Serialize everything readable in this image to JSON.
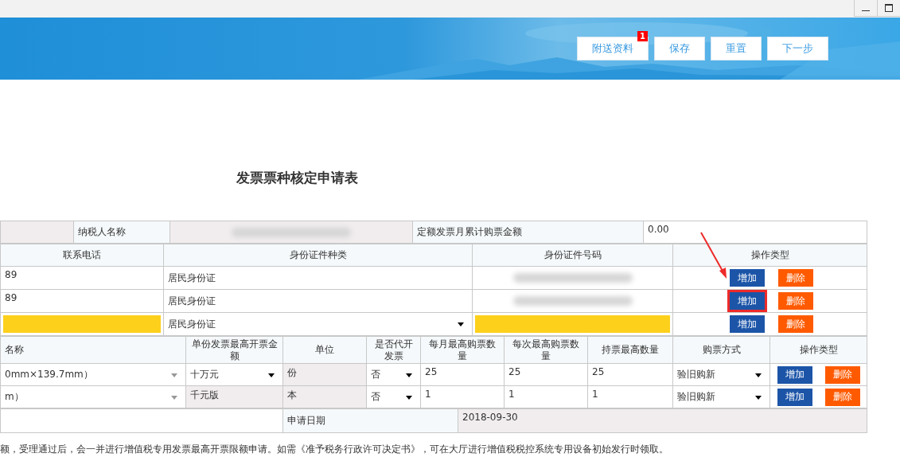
{
  "toolbar": {
    "buttons": [
      {
        "label": "附送资料",
        "badge": "1"
      },
      {
        "label": "保存"
      },
      {
        "label": "重置"
      },
      {
        "label": "下一步"
      }
    ]
  },
  "title": "发票票种核定申请表",
  "taxpayer": {
    "name_label": "纳税人名称",
    "amount_label": "定额发票月累计购票金额",
    "amount": "0.00"
  },
  "contacts": {
    "columns": [
      "联系电话",
      "身份证件种类",
      "身份证件号码",
      "操作类型"
    ],
    "rows": [
      {
        "kind": "text",
        "phone": "89",
        "id_type": "居民身份证",
        "add": "增加",
        "delete": "删除",
        "arrow_points_here": true,
        "outlined": false
      },
      {
        "kind": "text",
        "phone": "89",
        "id_type": "居民身份证",
        "add": "增加",
        "delete": "删除",
        "arrow_points_here": false,
        "outlined": true
      },
      {
        "kind": "input",
        "id_type": "居民身份证",
        "add": "增加",
        "delete": "删除",
        "arrow_points_here": false,
        "outlined": false
      }
    ]
  },
  "invoices": {
    "columns": [
      "名称",
      "单份发票最高开票金额",
      "单位",
      "是否代开发票",
      "每月最高购票数量",
      "每次最高购票数量",
      "持票最高数量",
      "购票方式",
      "操作类型"
    ],
    "rows": [
      {
        "name": "0mm×139.7mm）",
        "max_amount_editable": true,
        "max_amount": "十万元",
        "unit": "份",
        "agent": "否",
        "monthly": "25",
        "per_time": "25",
        "holding": "25",
        "method": "验旧购新",
        "add": "增加",
        "delete": "删除"
      },
      {
        "name": "m）",
        "max_amount_editable": false,
        "max_amount": "千元版",
        "unit": "本",
        "agent": "否",
        "monthly": "1",
        "per_time": "1",
        "holding": "1",
        "method": "验旧购新",
        "add": "增加",
        "delete": "删除"
      }
    ]
  },
  "date_row": {
    "label": "申请日期",
    "value": "2018-09-30"
  },
  "note": "额，受理通过后，会一并进行增值税专用发票最高开票限额申请。如需《准予税务行政许可决定书》，可在大厅进行增值税税控系统专用设备初始发行时领取。"
}
